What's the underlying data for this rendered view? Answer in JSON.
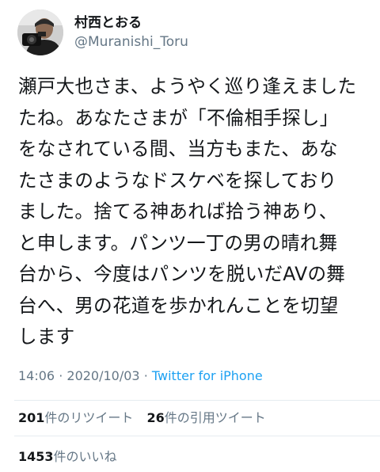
{
  "author": {
    "display_name": "村西とおる",
    "handle": "@Muranishi_Toru"
  },
  "tweet": {
    "text": "瀬戸大也さま、ようやく巡り逢えました\nたね。あなたさまが「不倫相手探し」\nをなされている間、当方もまた、あな\nたさまのようなドスケベを探しており\nました。捨てる神あれば拾う神あり、\nと申します。パンツ一丁の男の晴れ舞\n台から、今度はパンツを脱いだAVの舞\n台へ、男の花道を歩かれんことを切望\nします",
    "time": "14:06",
    "date": "2020/10/03",
    "separator": "·",
    "source": "Twitter for iPhone"
  },
  "stats": {
    "retweets": {
      "count": "201",
      "label": "件のリツイート"
    },
    "quotes": {
      "count": "26",
      "label": "件の引用ツイート"
    },
    "likes": {
      "count": "1453",
      "label": "件のいいね"
    }
  },
  "colors": {
    "text": "#14171a",
    "muted": "#657786",
    "link": "#1da1f2",
    "divider": "#e6ecf0"
  },
  "icons": {
    "avatar": "profile-photo",
    "more": "chevron-down-icon"
  }
}
